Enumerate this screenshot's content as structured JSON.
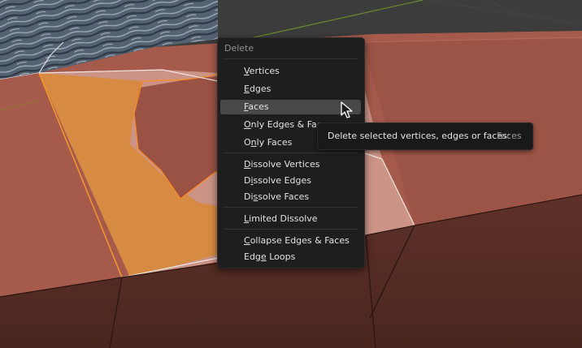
{
  "menu": {
    "title": "Delete",
    "items": [
      {
        "pre": "",
        "key": "V",
        "post": "ertices"
      },
      {
        "pre": "",
        "key": "E",
        "post": "dges"
      },
      {
        "pre": "",
        "key": "F",
        "post": "aces"
      },
      {
        "pre": "",
        "key": "O",
        "post": "nly Edges & Faces"
      },
      {
        "pre": "O",
        "key": "n",
        "post": "ly Faces"
      },
      {
        "pre": "",
        "key": "D",
        "post": "issolve Vertices"
      },
      {
        "pre": "D",
        "key": "i",
        "post": "ssolve Edges"
      },
      {
        "pre": "Di",
        "key": "s",
        "post": "solve Faces"
      },
      {
        "pre": "",
        "key": "L",
        "post": "imited Dissolve"
      },
      {
        "pre": "",
        "key": "C",
        "post": "ollapse Edges & Faces"
      },
      {
        "pre": "Edg",
        "key": "e",
        "post": " Loops"
      }
    ]
  },
  "tooltip": {
    "text": "Delete selected vertices, edges or faces:",
    "value": "Faces"
  },
  "colors": {
    "face": "#a55a4b",
    "face_dark": "#5e3027",
    "selection": "#e8902c",
    "background": "#3a3a3a",
    "menu_bg": "#1e1e1e"
  }
}
